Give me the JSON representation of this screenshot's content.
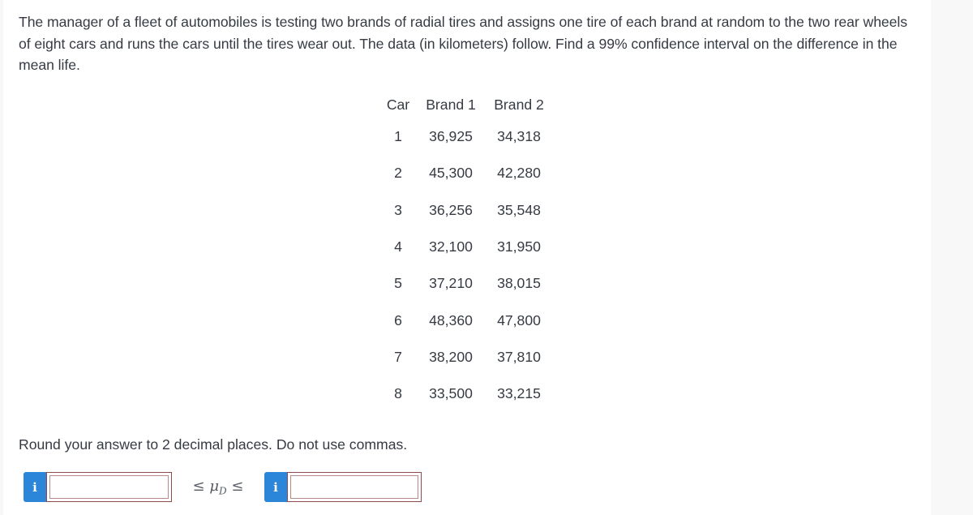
{
  "problem": {
    "text": "The manager of a fleet of automobiles is testing two brands of radial tires and assigns one tire of each brand at random to the two rear wheels of eight cars and runs the cars until the tires wear out. The data (in kilometers) follow. Find a 99% confidence interval on the difference in the mean life."
  },
  "table": {
    "headers": [
      "Car",
      "Brand 1",
      "Brand 2"
    ],
    "rows": [
      [
        "1",
        "36,925",
        "34,318"
      ],
      [
        "2",
        "45,300",
        "42,280"
      ],
      [
        "3",
        "36,256",
        "35,548"
      ],
      [
        "4",
        "32,100",
        "31,950"
      ],
      [
        "5",
        "37,210",
        "38,015"
      ],
      [
        "6",
        "48,360",
        "47,800"
      ],
      [
        "7",
        "38,200",
        "37,810"
      ],
      [
        "8",
        "33,500",
        "33,215"
      ]
    ]
  },
  "instruction": "Round your answer to 2 decimal places. Do not use commas.",
  "answer": {
    "info_label": "i",
    "lower_value": "",
    "upper_value": "",
    "relation_left": "≤ ",
    "mu_symbol": "μ",
    "mu_subscript": "D",
    "relation_right": " ≤",
    "accent_color": "#2b86d9"
  }
}
